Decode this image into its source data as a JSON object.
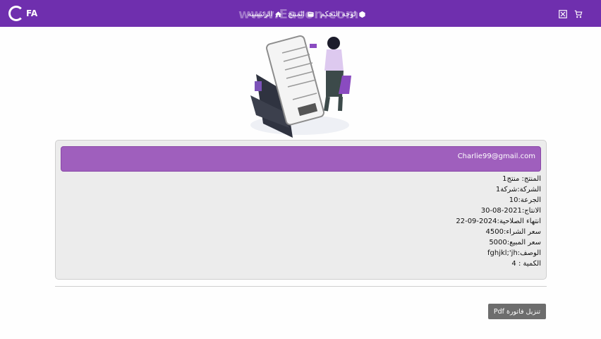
{
  "brand": {
    "text": "FA"
  },
  "nav": {
    "items": [
      {
        "label": "الرئيسية",
        "icon": "home-icon"
      },
      {
        "label": "المنتج",
        "icon": "box-icon"
      },
      {
        "label": "لوحة التحكم",
        "icon": "dashboard-icon"
      }
    ],
    "right_icons": [
      "cart-icon",
      "screen-record-icon"
    ]
  },
  "overlay": {
    "watermark": "www.Eason.com"
  },
  "card": {
    "email": "Charlie99@gmail.com",
    "details": [
      "المنتج: منتج1",
      "الشركة:شركة1",
      "الجرعة:10",
      "الانتاج:2021-08-30",
      "انتهاء الصلاحية:2024-09-22",
      "سعر الشراء:4500",
      "سعر المبيع:5000",
      "الوصف:fghjkl;'jh",
      "الكمية : 4"
    ]
  },
  "buttons": {
    "download_pdf": "تنزيل فاتورة Pdf"
  },
  "colors": {
    "navbar": "#6f2fae",
    "card_header": "#9f5fbd",
    "button": "#6d6d6d"
  }
}
